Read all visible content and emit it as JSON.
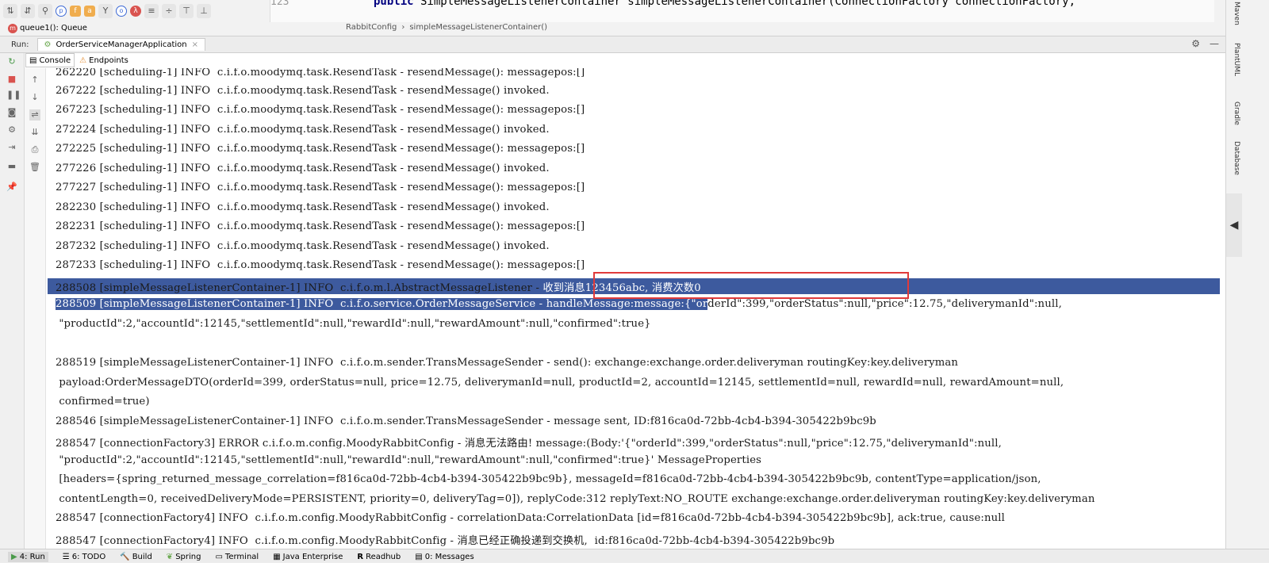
{
  "top": {
    "queue_label": "queue1(): Queue",
    "gutter_num": "123",
    "code_keyword": "public",
    "code_rest": " SimpleMessageListenerContainer simpleMessageListenerContainer(ConnectionFactory connectionFactory,",
    "breadcrumb": [
      "RabbitConfig",
      "simpleMessageListenerContainer()"
    ]
  },
  "run": {
    "label": "Run:",
    "tab": "OrderServiceManagerApplication"
  },
  "console_tabs": [
    "Console",
    "Endpoints"
  ],
  "console": {
    "lines": [
      "262220 [scheduling-1] INFO  c.i.f.o.moodymq.task.ResendTask - resendMessage(): messagepos:[]",
      "267222 [scheduling-1] INFO  c.i.f.o.moodymq.task.ResendTask - resendMessage() invoked.",
      "267223 [scheduling-1] INFO  c.i.f.o.moodymq.task.ResendTask - resendMessage(): messagepos:[]",
      "272224 [scheduling-1] INFO  c.i.f.o.moodymq.task.ResendTask - resendMessage() invoked.",
      "272225 [scheduling-1] INFO  c.i.f.o.moodymq.task.ResendTask - resendMessage(): messagepos:[]",
      "277226 [scheduling-1] INFO  c.i.f.o.moodymq.task.ResendTask - resendMessage() invoked.",
      "277227 [scheduling-1] INFO  c.i.f.o.moodymq.task.ResendTask - resendMessage(): messagepos:[]",
      "282230 [scheduling-1] INFO  c.i.f.o.moodymq.task.ResendTask - resendMessage() invoked.",
      "282231 [scheduling-1] INFO  c.i.f.o.moodymq.task.ResendTask - resendMessage(): messagepos:[]",
      "287232 [scheduling-1] INFO  c.i.f.o.moodymq.task.ResendTask - resendMessage() invoked.",
      "287233 [scheduling-1] INFO  c.i.f.o.moodymq.task.ResendTask - resendMessage(): messagepos:[]"
    ],
    "line_288508_a": "288508 [simpleMessageListenerContainer-1] INFO  c.i.f.o.m.l.AbstractMessageListener - ",
    "line_288508_b": "收到消息123456abc, 消费次数0",
    "line_288509_a": "288509 [simpleMessageListenerContainer-1] INFO  c.i.f.o.service.OrderMessageService - handleMessage:message:{\"or",
    "line_288509_b": "derId\":399,\"orderStatus\":null,\"price\":12.75,\"deliverymanId\":null,",
    "line_288509_c": " \"productId\":2,\"accountId\":12145,\"settlementId\":null,\"rewardId\":null,\"rewardAmount\":null,\"confirmed\":true}",
    "line_288519_a": "288519 [simpleMessageListenerContainer-1] INFO  c.i.f.o.m.sender.TransMessageSender - send(): exchange:exchange.order.deliveryman routingKey:key.deliveryman",
    "line_288519_b": " payload:OrderMessageDTO(orderId=399, orderStatus=null, price=12.75, deliverymanId=null, productId=2, accountId=12145, settlementId=null, rewardId=null, rewardAmount=null,",
    "line_288519_c": " confirmed=true)",
    "line_288546": "288546 [simpleMessageListenerContainer-1] INFO  c.i.f.o.m.sender.TransMessageSender - message sent, ID:f816ca0d-72bb-4cb4-b394-305422b9bc9b",
    "line_288547_a": "288547 [connectionFactory3] ERROR c.i.f.o.m.config.MoodyRabbitConfig - 消息无法路由! message:(Body:'{\"orderId\":399,\"orderStatus\":null,\"price\":12.75,\"deliverymanId\":null,",
    "line_288547_b": " \"productId\":2,\"accountId\":12145,\"settlementId\":null,\"rewardId\":null,\"rewardAmount\":null,\"confirmed\":true}' MessageProperties",
    "line_288547_c": " [headers={spring_returned_message_correlation=f816ca0d-72bb-4cb4-b394-305422b9bc9b}, messageId=f816ca0d-72bb-4cb4-b394-305422b9bc9b, contentType=application/json,",
    "line_288547_d": " contentLength=0, receivedDeliveryMode=PERSISTENT, priority=0, deliveryTag=0]), replyCode:312 replyText:NO_ROUTE exchange:exchange.order.deliveryman routingKey:key.deliveryman",
    "line_288547_e": "288547 [connectionFactory4] INFO  c.i.f.o.m.config.MoodyRabbitConfig - correlationData:CorrelationData [id=f816ca0d-72bb-4cb4-b394-305422b9bc9b], ack:true, cause:null",
    "line_288547_f": "288547 [connectionFactory4] INFO  c.i.f.o.m.config.MoodyRabbitConfig - 消息已经正确投递到交换机,  id:f816ca0d-72bb-4cb4-b394-305422b9bc9b"
  },
  "right_tools": [
    "Maven",
    "PlantUML",
    "Gradle",
    "Database"
  ],
  "bottom_tabs": [
    "4: Run",
    "6: TODO",
    "Build",
    "Spring",
    "Terminal",
    "Java Enterprise",
    "Readhub",
    "0: Messages"
  ],
  "colors": {
    "selection": "#3d5a9e",
    "highlight_box": "#e03a3a"
  }
}
